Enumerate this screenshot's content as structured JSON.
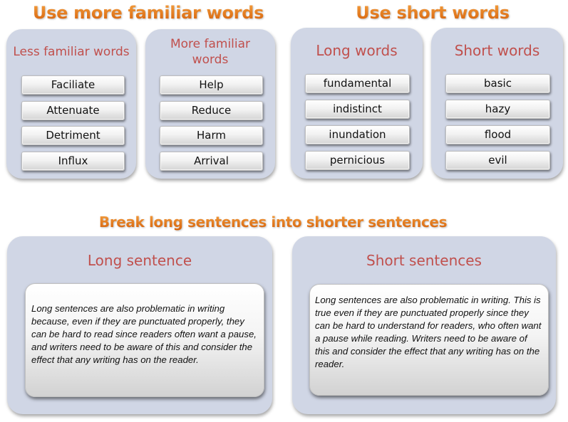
{
  "sections": {
    "familiar": {
      "heading": "Use more familiar words",
      "left": {
        "title": "Less familiar words",
        "words": [
          "Faciliate",
          "Attenuate",
          "Detriment",
          "Influx"
        ]
      },
      "right": {
        "title": "More familiar words",
        "words": [
          "Help",
          "Reduce",
          "Harm",
          "Arrival"
        ]
      }
    },
    "short": {
      "heading": "Use short words",
      "left": {
        "title": "Long words",
        "words": [
          "fundamental",
          "indistinct",
          "inundation",
          "pernicious"
        ]
      },
      "right": {
        "title": "Short words",
        "words": [
          "basic",
          "hazy",
          "flood",
          "evil"
        ]
      }
    },
    "sentences": {
      "heading": "Break long sentences into shorter sentences",
      "left": {
        "title": "Long sentence",
        "text": "Long sentences are also problematic in writing because, even if they are punctuated properly, they can be hard to read since readers often want a pause, and writers need to be aware of this and consider the effect that any writing has on the reader."
      },
      "right": {
        "title": "Short sentences",
        "text": "Long sentences are also problematic in writing.  This is true even if they are punctuated properly since they can be hard to understand for readers, who often want a pause while reading.  Writers need to be aware of this and consider the effect that any writing has on the reader."
      }
    }
  },
  "colors": {
    "heading": "#e36c0a",
    "panel_title": "#c0504d",
    "panel_bg": "#d0d6e5"
  }
}
